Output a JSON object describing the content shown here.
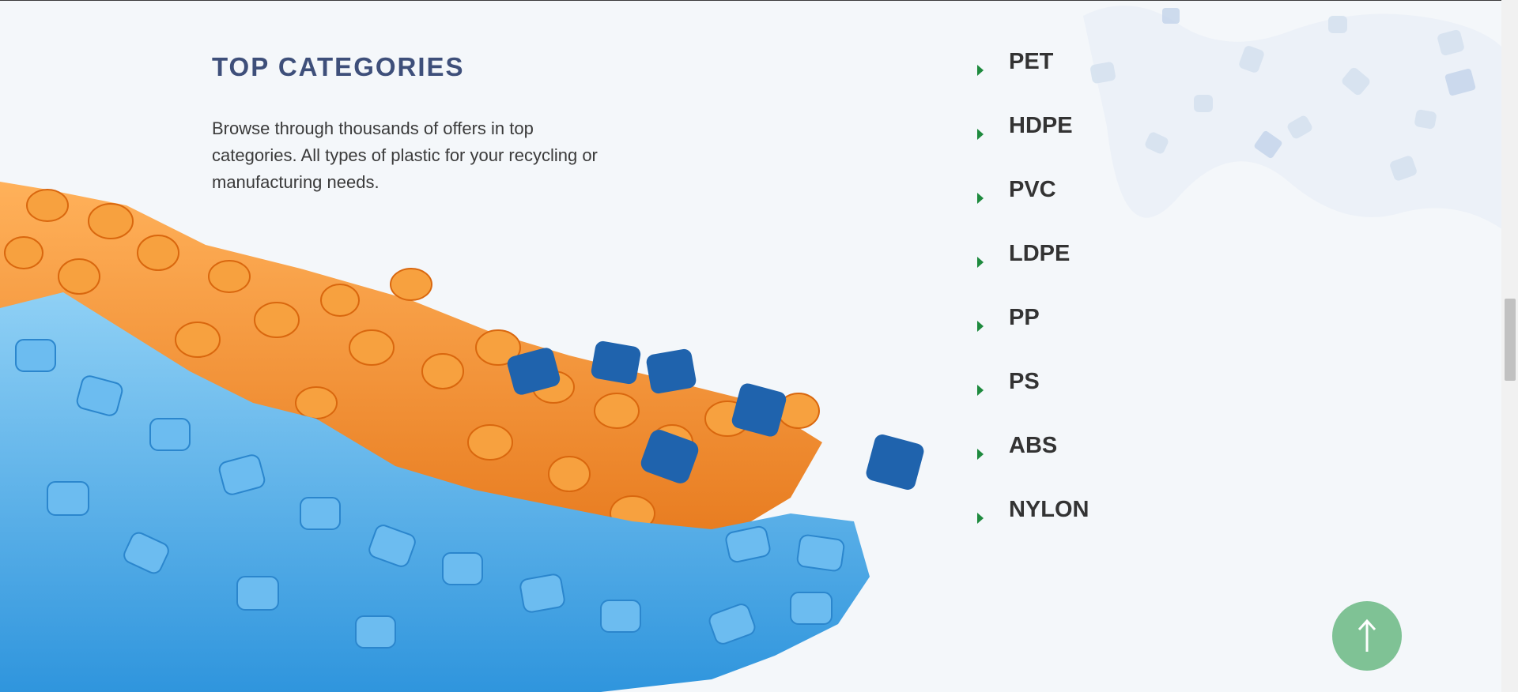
{
  "section": {
    "title": "TOP CATEGORIES",
    "description": "Browse through thousands of offers in top categories. All types of plastic for your recycling or manufacturing needs."
  },
  "categories": [
    {
      "label": "PET"
    },
    {
      "label": "HDPE"
    },
    {
      "label": "PVC"
    },
    {
      "label": "LDPE"
    },
    {
      "label": "PP"
    },
    {
      "label": "PS"
    },
    {
      "label": "ABS"
    },
    {
      "label": "NYLON"
    }
  ],
  "colors": {
    "title": "#3e4f7a",
    "caret": "#1e8a3e",
    "back_to_top": "#7fc295",
    "orange_pellet": "#f08a24",
    "light_blue_pellet": "#3aa5e6",
    "dark_blue_pellet": "#1e64b0"
  },
  "icons": {
    "category_caret": "caret-right-icon",
    "back_to_top": "arrow-up-icon"
  }
}
